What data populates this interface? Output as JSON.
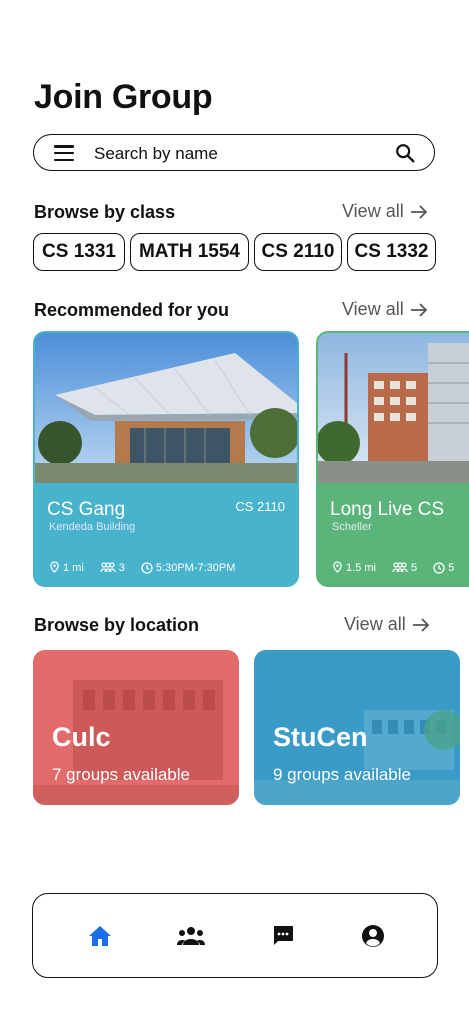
{
  "page_title": "Join Group",
  "search": {
    "placeholder": "Search by name"
  },
  "browse_by_class": {
    "title": "Browse by class",
    "view_all": "View all",
    "chips": [
      "CS 1331",
      "MATH 1554",
      "CS 2110",
      "CS 1332"
    ]
  },
  "recommended": {
    "title": "Recommended for you",
    "view_all": "View all",
    "cards": [
      {
        "name": "CS Gang",
        "location": "Kendeda Building",
        "class": "CS 2110",
        "distance": "1 mi",
        "members": "3",
        "time": "5:30PM-7:30PM",
        "color": "#48b3cc"
      },
      {
        "name": "Long Live CS",
        "location": "Scheller",
        "class": "",
        "distance": "1.5 mi",
        "members": "5",
        "time": "5",
        "color": "#5bb57a"
      }
    ]
  },
  "browse_by_location": {
    "title": "Browse by location",
    "view_all": "View all",
    "cards": [
      {
        "name": "Culc",
        "count": "7 groups available",
        "color": "#e46b6b"
      },
      {
        "name": "StuCen",
        "count": "9 groups available",
        "color": "#3a9bc6"
      }
    ]
  },
  "bottom_nav": {
    "items": [
      "home-icon",
      "groups-icon",
      "chat-icon",
      "profile-icon"
    ],
    "active_color": "#1a6ee8",
    "inactive_color": "#111111"
  }
}
